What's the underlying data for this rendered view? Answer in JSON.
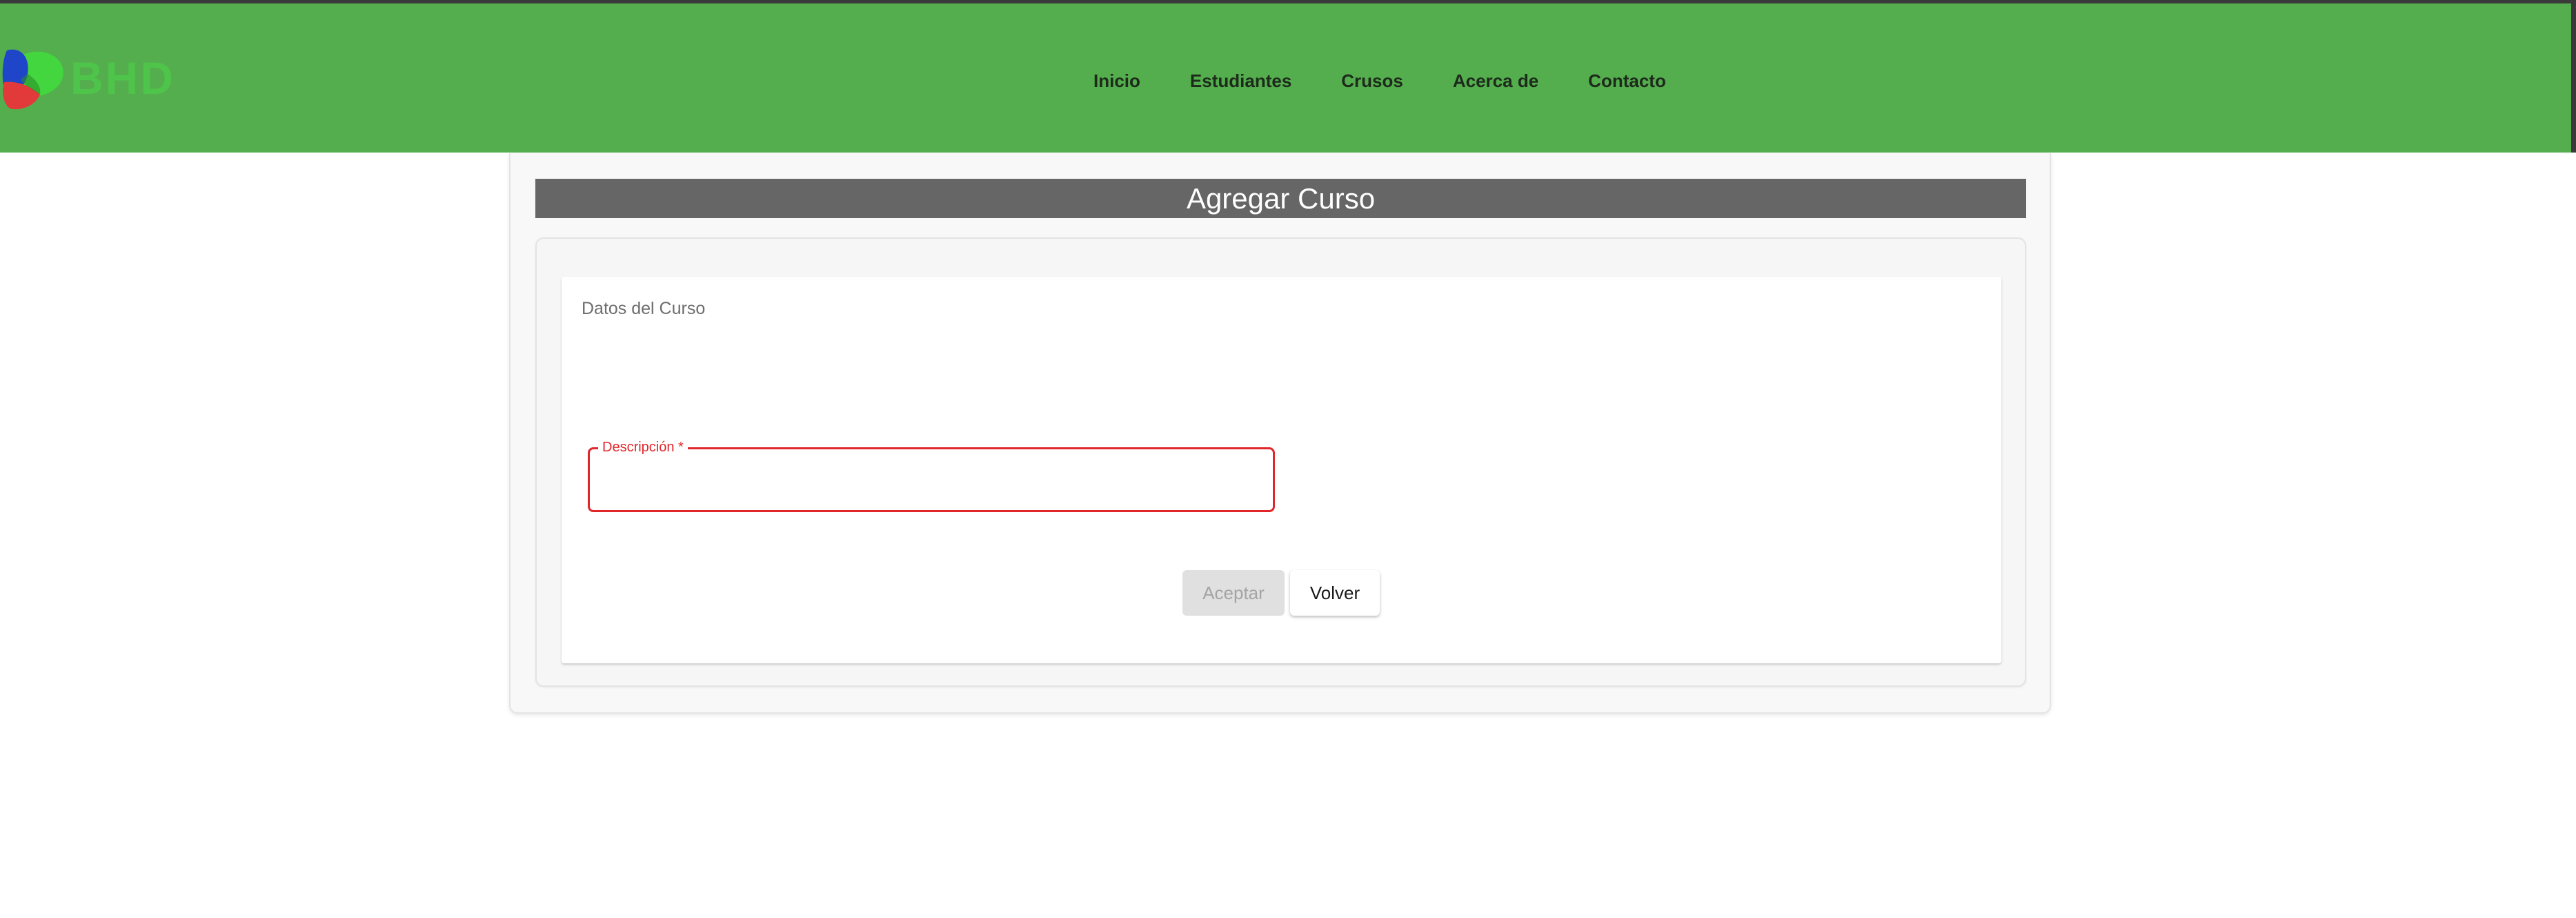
{
  "brand": {
    "logo_text": "BHD",
    "logo_icon": "bhd-logo-mark"
  },
  "nav": {
    "items": [
      {
        "label": "Inicio"
      },
      {
        "label": "Estudiantes"
      },
      {
        "label": "Crusos"
      },
      {
        "label": "Acerca de"
      },
      {
        "label": "Contacto"
      }
    ]
  },
  "page": {
    "title": "Agregar Curso"
  },
  "form": {
    "section_label": "Datos del Curso",
    "description_field": {
      "label": "Descripción *",
      "value": ""
    },
    "accept_label": "Aceptar",
    "back_label": "Volver"
  },
  "colors": {
    "header": "#54ae4d",
    "title_bar": "#666666",
    "error": "#e0262b",
    "logo_text": "#4fc44a"
  }
}
